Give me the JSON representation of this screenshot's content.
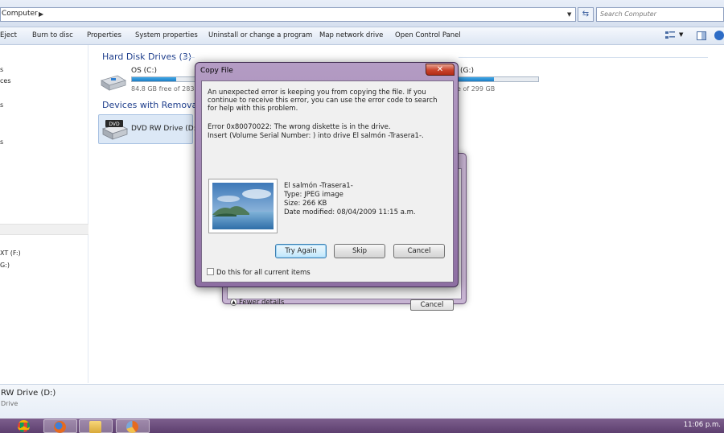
{
  "address_bar": {
    "path": "Computer",
    "search_placeholder": "Search Computer"
  },
  "command_bar": {
    "items": [
      "Eject",
      "Burn to disc",
      "Properties",
      "System properties",
      "Uninstall or change a program",
      "Map network drive",
      "Open Control Panel"
    ]
  },
  "navigation": {
    "items": [
      "s",
      "ces",
      "s",
      "s",
      "XT (F:)",
      "G:)"
    ]
  },
  "content": {
    "hard_disk_header": "Hard Disk Drives (3)",
    "devices_header": "Devices with Removable",
    "drive_os": {
      "name": "OS (C:)",
      "free": "84.8 GB free of 283 G",
      "used_fraction": 0.7
    },
    "drive_g": {
      "name": "(G:)",
      "free": "e of 299 GB",
      "used_fraction": 0.45
    },
    "drive_dvd": {
      "name": "DVD RW Drive (D:)",
      "icon_text": "DVD"
    }
  },
  "details_pane": {
    "name": "RW Drive (D:)",
    "type": "Drive"
  },
  "background_dialog": {
    "fewer_details": "Fewer details",
    "cancel": "Cancel"
  },
  "dialog": {
    "title": "Copy File",
    "message": "An unexpected error is keeping you from copying the file. If you continue to receive this error, you can use the error code to search for help with this problem.",
    "error_line1": "Error 0x80070022: The wrong diskette is in the drive.",
    "error_line2": "Insert  (Volume Serial Number: ) into drive El salmón -Trasera1-.",
    "file_name": "El salmón -Trasera1-",
    "file_type": "Type: JPEG image",
    "file_size": "Size: 266 KB",
    "file_date": "Date modified: 08/04/2009 11:15 a.m.",
    "try_again": "Try Again",
    "skip": "Skip",
    "cancel": "Cancel",
    "checkbox_label": "Do this for all current items"
  },
  "taskbar": {
    "clock": "11:06 p.m."
  },
  "colors": {
    "taskbar": "#6b4d7d",
    "link_header": "#1e3e8c",
    "capacity_fill": "#2a8fd4"
  }
}
